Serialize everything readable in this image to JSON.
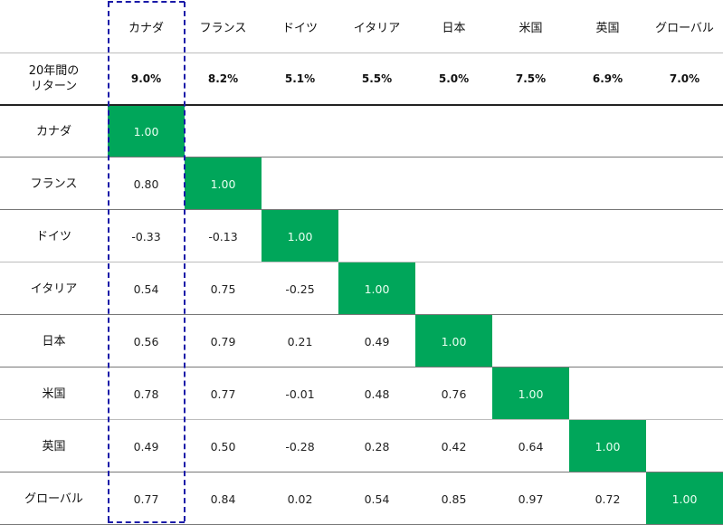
{
  "chart_data": {
    "type": "table",
    "title": "",
    "corner_label": "",
    "return_row_label_lines": [
      "20年間の",
      "リターン"
    ],
    "columns": [
      "カナダ",
      "フランス",
      "ドイツ",
      "イタリア",
      "日本",
      "米国",
      "英国",
      "グローバル"
    ],
    "returns": [
      "9.0%",
      "8.2%",
      "5.1%",
      "5.5%",
      "5.0%",
      "7.5%",
      "6.9%",
      "7.0%"
    ],
    "rows": [
      {
        "label": "カナダ",
        "values": [
          "1.00"
        ]
      },
      {
        "label": "フランス",
        "values": [
          "0.80",
          "1.00"
        ]
      },
      {
        "label": "ドイツ",
        "values": [
          "-0.33",
          "-0.13",
          "1.00"
        ]
      },
      {
        "label": "イタリア",
        "values": [
          "0.54",
          "0.75",
          "-0.25",
          "1.00"
        ]
      },
      {
        "label": "日本",
        "values": [
          "0.56",
          "0.79",
          "0.21",
          "0.49",
          "1.00"
        ]
      },
      {
        "label": "米国",
        "values": [
          "0.78",
          "0.77",
          "-0.01",
          "0.48",
          "0.76",
          "1.00"
        ]
      },
      {
        "label": "英国",
        "values": [
          "0.49",
          "0.50",
          "-0.28",
          "0.28",
          "0.42",
          "0.64",
          "1.00"
        ]
      },
      {
        "label": "グローバル",
        "values": [
          "0.77",
          "0.84",
          "0.02",
          "0.54",
          "0.85",
          "0.97",
          "0.72",
          "1.00"
        ]
      }
    ],
    "highlighted_column": "カナダ",
    "colors": {
      "diagonal": "#00a65a",
      "highlight_border": "#1a1aa8"
    }
  }
}
